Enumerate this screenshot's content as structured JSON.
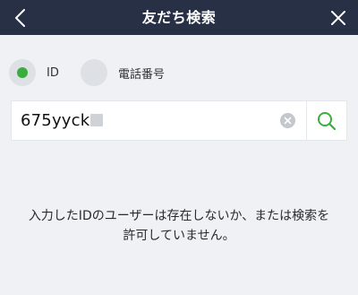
{
  "header": {
    "title": "友だち検索",
    "back_icon": "chevron-left-icon",
    "close_icon": "close-icon"
  },
  "search_type": {
    "selected": "ID",
    "options": [
      {
        "label": "ID",
        "selected": true
      },
      {
        "label": "電話番号",
        "selected": false
      }
    ]
  },
  "search": {
    "value": "675yyck",
    "clear_icon": "clear-icon",
    "search_icon": "search-icon"
  },
  "result_message": "入力したIDのユーザーは存在しないか、または検索を許可していません。",
  "colors": {
    "header_bg": "#283046",
    "accent_green": "#3aae3c",
    "page_bg": "#eff1f5"
  }
}
